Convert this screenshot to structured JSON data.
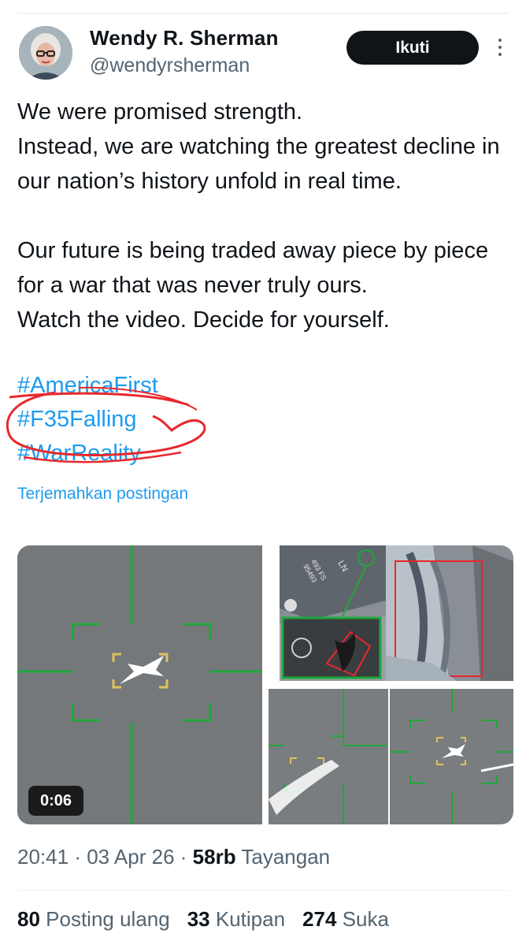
{
  "author": {
    "name": "Wendy R. Sherman",
    "handle": "@wendyrsherman",
    "follow_label": "Ikuti"
  },
  "post": {
    "text": "We were promised strength.\nInstead, we are watching the greatest decline in our nation’s history unfold in real time.\n\nOur future is being traded away piece by piece for a war that was never truly ours.\nWatch the video. Decide for yourself.",
    "hashtags": [
      "#AmericaFirst",
      "#F35Falling",
      "#WarReality"
    ],
    "translate_label": "Terjemahkan postingan"
  },
  "media": {
    "video_duration": "0:06",
    "plane_marking": "LN",
    "plane_serial_1": "493 FS",
    "plane_serial_2": "95493"
  },
  "meta": {
    "time": "20:41",
    "date": "03 Apr 26",
    "views_count": "58rb",
    "views_label": "Tayangan",
    "separator": "·"
  },
  "stats": {
    "reposts_count": "80",
    "reposts_label": "Posting ulang",
    "quotes_count": "33",
    "quotes_label": "Kutipan",
    "likes_count": "274",
    "likes_label": "Suka"
  },
  "colors": {
    "link": "#1d9bf0",
    "text": "#0f1419",
    "muted": "#536471",
    "annotation": "#e8282d",
    "reticle": "#1fa83a",
    "box": "#e0c060"
  }
}
